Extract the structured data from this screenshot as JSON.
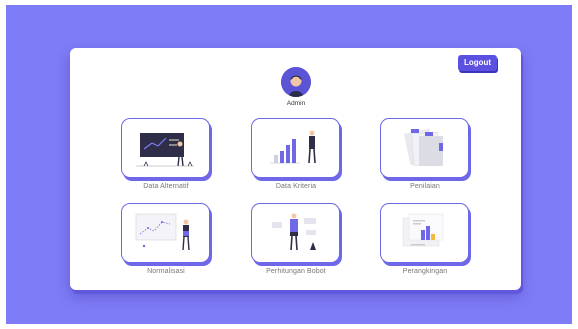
{
  "header": {
    "logout_label": "Logout"
  },
  "user": {
    "name": "Admin"
  },
  "menu": [
    {
      "label": "Data Alternatif"
    },
    {
      "label": "Data Kriteria"
    },
    {
      "label": "Penilaian"
    },
    {
      "label": "Normalisasi"
    },
    {
      "label": "Perhitungan Bobot"
    },
    {
      "label": "Perangkingan"
    }
  ],
  "colors": {
    "background": "#7f7cf8",
    "accent": "#5b50e0",
    "tile_border": "#6e68e8"
  }
}
